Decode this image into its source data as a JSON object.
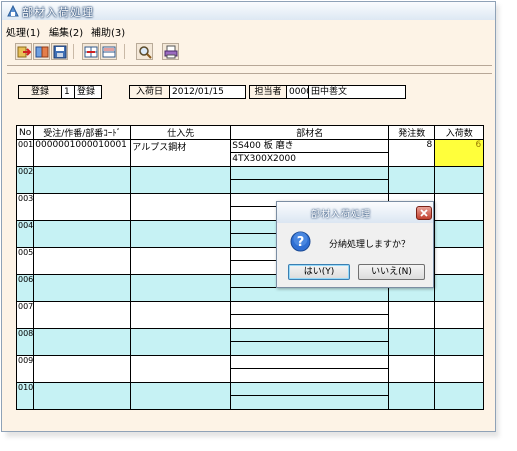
{
  "window": {
    "title": "部材入荷処理",
    "menu": [
      "処理(1)",
      "編集(2)",
      "補助(3)"
    ]
  },
  "toolbar": {
    "buttons": [
      {
        "icon": "exit-icon"
      },
      {
        "icon": "register-icon"
      },
      {
        "icon": "save-icon"
      },
      {
        "icon": "insert-row-icon"
      },
      {
        "icon": "delete-row-icon"
      },
      {
        "icon": "search-icon"
      },
      {
        "icon": "print-icon"
      }
    ]
  },
  "header": {
    "mode_label": "登録",
    "mode_code": "1",
    "mode_value": "登録",
    "date_label": "入荷日",
    "date_value": "2012/01/15",
    "person_label": "担当者",
    "person_code": "0000",
    "person_name": "田中善文"
  },
  "table": {
    "columns": [
      "No",
      "受注/作番/部番ｺｰﾄﾞ",
      "仕入先",
      "部材名",
      "発注数",
      "入荷数"
    ],
    "rows": [
      {
        "no": "001",
        "code": "0000001000010001",
        "supplier": "アルプス鋼材",
        "material": "SS400 板 磨き",
        "material_spec": "4TX300X2000",
        "ordered": "8",
        "received": "6"
      },
      {
        "no": "002",
        "code": "",
        "supplier": "",
        "material": "",
        "material_spec": "",
        "ordered": "",
        "received": ""
      },
      {
        "no": "003",
        "code": "",
        "supplier": "",
        "material": "",
        "material_spec": "",
        "ordered": "",
        "received": ""
      },
      {
        "no": "004",
        "code": "",
        "supplier": "",
        "material": "",
        "material_spec": "",
        "ordered": "",
        "received": ""
      },
      {
        "no": "005",
        "code": "",
        "supplier": "",
        "material": "",
        "material_spec": "",
        "ordered": "",
        "received": ""
      },
      {
        "no": "006",
        "code": "",
        "supplier": "",
        "material": "",
        "material_spec": "",
        "ordered": "",
        "received": ""
      },
      {
        "no": "007",
        "code": "",
        "supplier": "",
        "material": "",
        "material_spec": "",
        "ordered": "",
        "received": ""
      },
      {
        "no": "008",
        "code": "",
        "supplier": "",
        "material": "",
        "material_spec": "",
        "ordered": "",
        "received": ""
      },
      {
        "no": "009",
        "code": "",
        "supplier": "",
        "material": "",
        "material_spec": "",
        "ordered": "",
        "received": ""
      },
      {
        "no": "010",
        "code": "",
        "supplier": "",
        "material": "",
        "material_spec": "",
        "ordered": "",
        "received": ""
      }
    ]
  },
  "dialog": {
    "title": "部材入荷処理",
    "message": "分納処理しますか？",
    "yes_label": "はい(Y)",
    "no_label": "いいえ(N)"
  },
  "colors": {
    "window_bg": "#fdf3e6",
    "row_alt": "#c6f2f4",
    "highlight": "#ffff3b"
  }
}
